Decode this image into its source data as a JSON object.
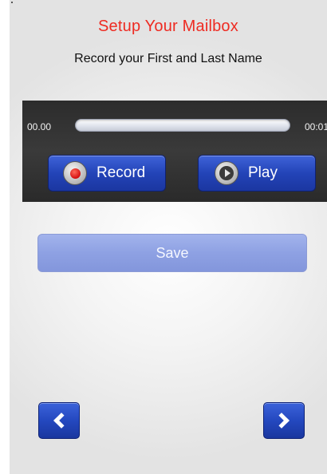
{
  "header": {
    "title": "Setup Your Mailbox",
    "subtitle": "Record your First and Last Name"
  },
  "recorder": {
    "time_start": "00.00",
    "time_end": "00:01",
    "progress": 0.0,
    "record_label": "Record",
    "play_label": "Play"
  },
  "actions": {
    "save_label": "Save"
  },
  "navigation": {
    "back_icon": "chevron-left-icon",
    "next_icon": "chevron-right-icon"
  },
  "colors": {
    "title": "#ee2b22",
    "button_blue": "#2344b8",
    "save_disabled": "#8ea1e3"
  }
}
